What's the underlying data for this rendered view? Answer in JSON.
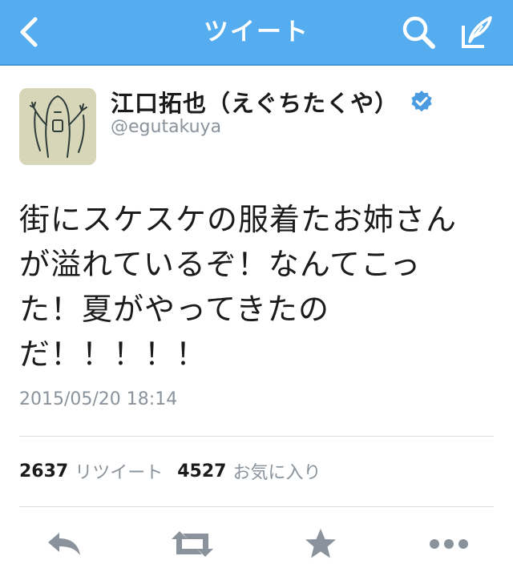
{
  "nav": {
    "title": "ツイート",
    "icons": {
      "back": "back-chevron-icon",
      "search": "search-icon",
      "compose": "compose-tweet-icon"
    }
  },
  "tweet": {
    "author_name": "江口拓也（えぐちたくや）",
    "handle": "@egutakuya",
    "verified": true,
    "text": "街にスケスケの服着たお姉さん\nが溢れているぞ！なんてこっ\nた！夏がやってきたの\nだ！！！！！",
    "timestamp": "2015/05/20 18:14"
  },
  "stats": {
    "retweet_count": "2637",
    "retweet_label": "リツイート",
    "favorite_count": "4527",
    "favorite_label": "お気に入り"
  },
  "actions": {
    "icons": [
      "reply-icon",
      "retweet-icon",
      "favorite-star-icon",
      "more-icon"
    ]
  },
  "colors": {
    "nav_background": "#55acee",
    "text_primary": "#1b1b1b",
    "text_secondary": "#8a939c",
    "icon_gray": "#8a939c",
    "verified_blue": "#4b9be0"
  }
}
